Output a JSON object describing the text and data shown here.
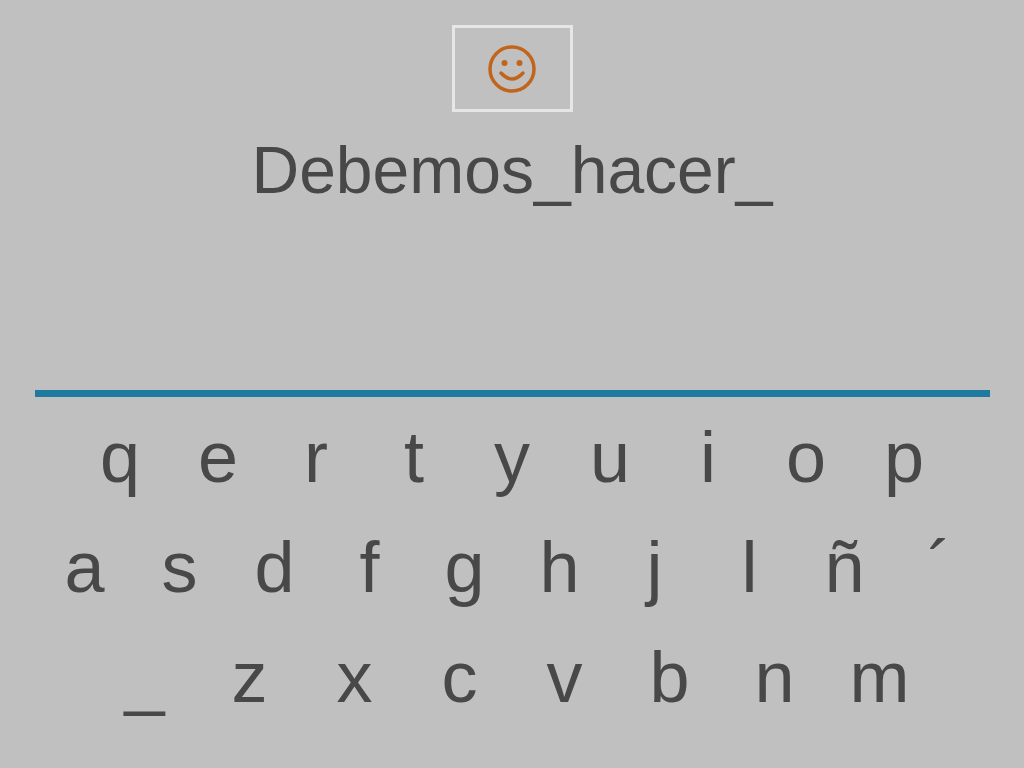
{
  "phrase": "Debemos_hacer_",
  "keyboard": {
    "rows": [
      [
        "q",
        "e",
        "r",
        "t",
        "y",
        "u",
        "i",
        "o",
        "p"
      ],
      [
        "a",
        "s",
        "d",
        "f",
        "g",
        "h",
        "j",
        "l",
        "ñ",
        "´"
      ],
      [
        "_",
        "z",
        "x",
        "c",
        "v",
        "b",
        "n",
        "m"
      ]
    ]
  }
}
